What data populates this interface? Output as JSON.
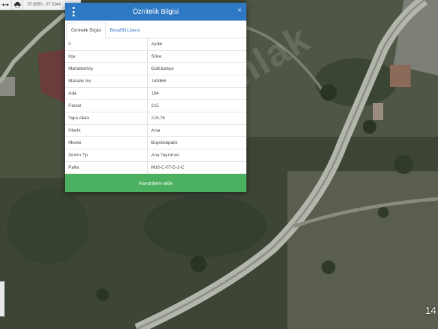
{
  "map": {
    "coordinates": "37.6850 - 27.3246",
    "zoom_level": "14",
    "watermark": "hepsiemlak"
  },
  "toolbar": {
    "icons": [
      "resize-icon",
      "print-icon"
    ]
  },
  "dialog": {
    "title": "Öznitelik Bilgisi",
    "close": "×",
    "tabs": [
      {
        "label": "Öznitelik Bilgisi",
        "active": true
      },
      {
        "label": "Bina/BB Listesi",
        "active": false
      }
    ],
    "rows": [
      {
        "key": "İl",
        "value": "Aydın"
      },
      {
        "key": "İlçe",
        "value": "Söke"
      },
      {
        "key": "Mahalle/Köy",
        "value": "Güllübahçe"
      },
      {
        "key": "Mahalle No",
        "value": "149368"
      },
      {
        "key": "Ada",
        "value": "104"
      },
      {
        "key": "Parsel",
        "value": "215"
      },
      {
        "key": "Tapu Alanı",
        "value": "216,75"
      },
      {
        "key": "Nitelik",
        "value": "Arsa"
      },
      {
        "key": "Mevkii",
        "value": "Büyükkapaklı"
      },
      {
        "key": "Zemin Tip",
        "value": "Ana Taşınmaz"
      },
      {
        "key": "Pafta",
        "value": "M18-C-07-D-2-C"
      }
    ],
    "button": "Favorilere ekle"
  },
  "colors": {
    "header": "#2f79c4",
    "button": "#4bb05f"
  }
}
